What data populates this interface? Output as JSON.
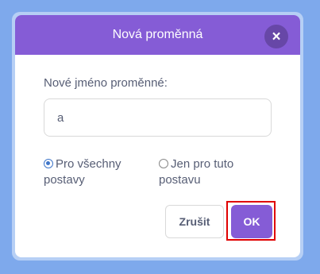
{
  "dialog": {
    "title": "Nová proměnná",
    "close_icon": "close-icon",
    "field_label": "Nové jméno proměnné:",
    "name_value": "a",
    "scope_options": [
      {
        "label": "Pro všechny postavy",
        "checked": true
      },
      {
        "label": "Jen pro tuto postavu",
        "checked": false
      }
    ],
    "cancel_label": "Zrušit",
    "ok_label": "OK"
  },
  "colors": {
    "backdrop": "#7ea9ec",
    "header": "#855cd6",
    "ok_button": "#855cd6",
    "radio_selected": "#3f76c9",
    "highlight": "#e00000",
    "text": "#575e75"
  }
}
